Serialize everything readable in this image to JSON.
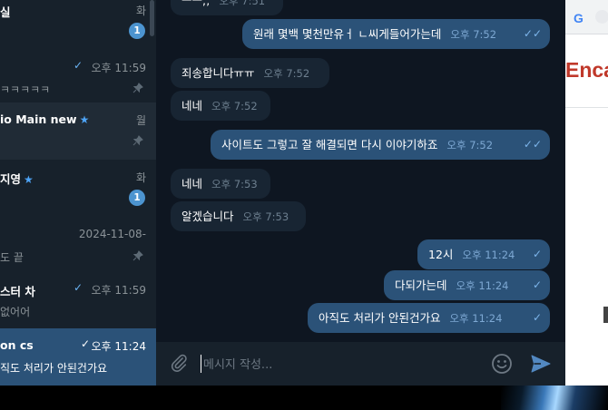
{
  "sidebar": {
    "chats": [
      {
        "title": "실",
        "time": "화",
        "preview": "",
        "badge": "1",
        "star": false,
        "check": false,
        "pinned": false
      },
      {
        "title": "",
        "time": "오후 11:59",
        "preview": "ㅋㅋㅋㅋㅋ",
        "badge": "",
        "star": false,
        "check": true,
        "pinned": true
      },
      {
        "title": "io Main new",
        "time": "월",
        "preview": "",
        "badge": "",
        "star": true,
        "check": false,
        "pinned": true
      },
      {
        "title": "지영",
        "time": "화",
        "preview": "",
        "badge": "1",
        "star": true,
        "check": false,
        "pinned": false
      },
      {
        "title": "",
        "time": "2024-11-08-",
        "preview": "도 끝",
        "badge": "",
        "star": false,
        "check": false,
        "pinned": true
      },
      {
        "title": "스터 차",
        "time": "오후 11:59",
        "preview": "없어어",
        "badge": "",
        "star": false,
        "check": true,
        "pinned": false
      },
      {
        "title": "on cs",
        "time": "오후 11:24",
        "preview": "직도 처리가 안된건가요",
        "badge": "",
        "star": false,
        "check": true,
        "pinned": false
      }
    ]
  },
  "messages": [
    {
      "dir": "in",
      "text": "ㅡㅡ;;",
      "time": "오후 7:51",
      "checks": ""
    },
    {
      "dir": "out",
      "text": "원래 몇백 몇천만유ㅓ ㄴ씨게들어가는데",
      "time": "오후 7:52",
      "checks": "✓✓"
    },
    {
      "dir": "in",
      "text": "죄송합니다ㅠㅠ",
      "time": "오후 7:52",
      "checks": ""
    },
    {
      "dir": "in",
      "text": "네네",
      "time": "오후 7:52",
      "checks": ""
    },
    {
      "dir": "out",
      "text": "사이트도 그렇고 잘 해결되면 다시 이야기하죠",
      "time": "오후 7:52",
      "checks": "✓✓"
    },
    {
      "dir": "in",
      "text": "네네",
      "time": "오후 7:53",
      "checks": ""
    },
    {
      "dir": "in",
      "text": "알겠습니다",
      "time": "오후 7:53",
      "checks": ""
    },
    {
      "dir": "out",
      "text": "12시",
      "time": "오후 11:24",
      "checks": "✓"
    },
    {
      "dir": "out",
      "text": "다되가는데",
      "time": "오후 11:24",
      "checks": "✓"
    },
    {
      "dir": "out",
      "text": "아직도 처리가 안된건가요",
      "time": "오후 11:24",
      "checks": "✓"
    }
  ],
  "composer": {
    "placeholder": "메시지 작성...",
    "icons": [
      "paperclip-icon",
      "emoji-icon",
      "send-icon"
    ]
  },
  "browser": {
    "favicon": "G",
    "heading": "Enca"
  },
  "colors": {
    "sidebar_bg": "#17212b",
    "selected_chat": "#2b5278",
    "chat_bg": "#0e1621",
    "incoming_bubble": "#182533",
    "outgoing_bubble": "#2b5278",
    "accent": "#4ea4f6"
  }
}
